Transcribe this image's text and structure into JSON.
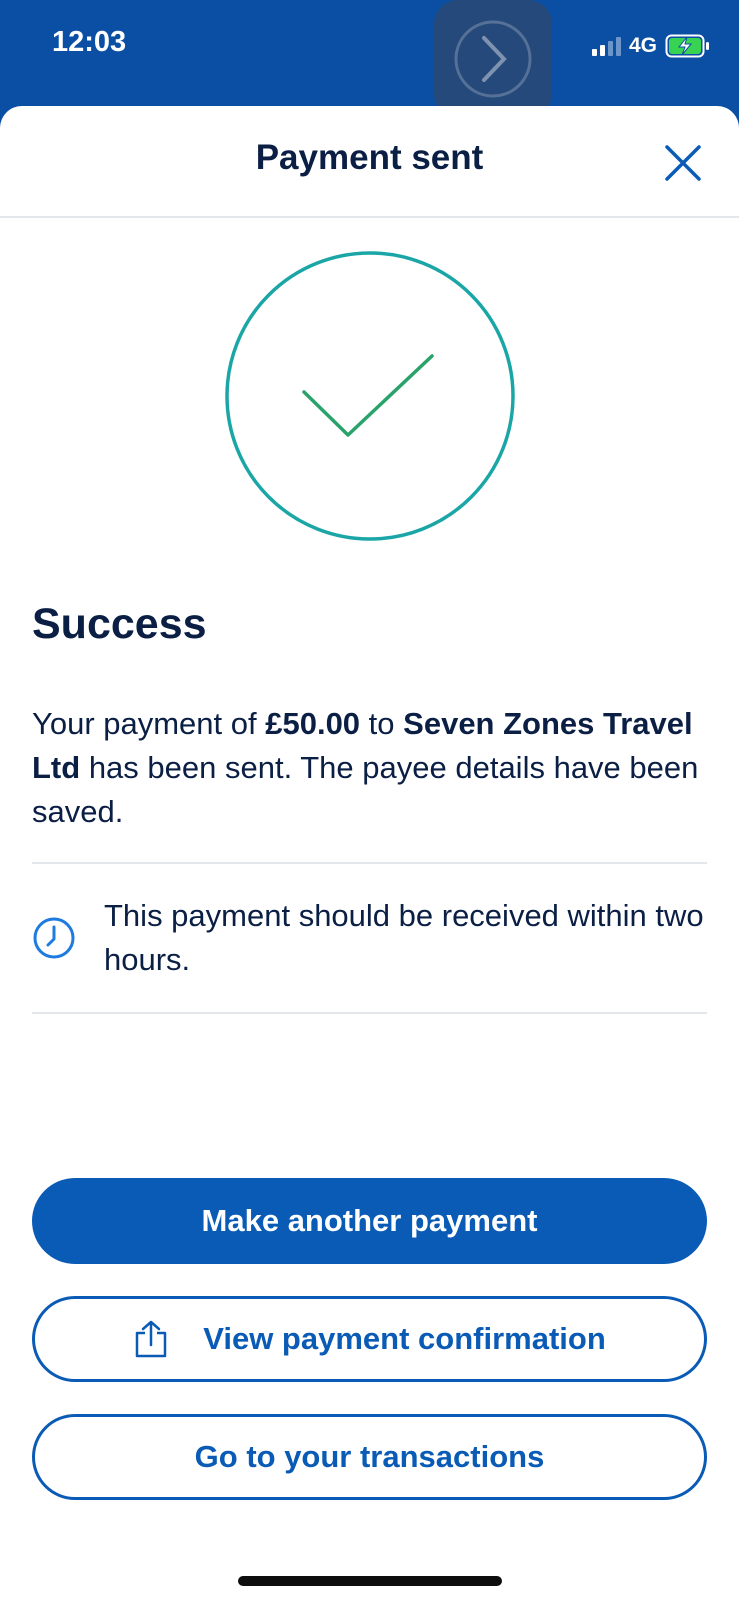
{
  "status_bar": {
    "time": "12:03",
    "network": "4G",
    "icons": [
      "signal-bars-icon",
      "battery-charging-icon"
    ]
  },
  "header": {
    "title": "Payment sent",
    "close_icon": "close-icon"
  },
  "success": {
    "icon": "checkmark-circle-icon",
    "heading": "Success",
    "message_part1": "Your payment of ",
    "amount": "£50.00",
    "message_part2": " to ",
    "payee": "Seven Zones Travel Ltd",
    "message_part3": " has been sent. The payee details have been saved."
  },
  "notice": {
    "icon": "clock-icon",
    "text": "This payment should be received within two hours."
  },
  "actions": {
    "make_another_label": "Make another payment",
    "view_confirmation_label": "View payment confirmation",
    "view_confirmation_icon": "share-icon",
    "transactions_label": "Go to your transactions"
  },
  "colors": {
    "brand_blue": "#0a5bb5",
    "status_bar_blue": "#0a4fa3",
    "text_navy": "#0b1f45",
    "circle_teal": "#1aa6a6",
    "check_green": "#2aa36b",
    "divider": "#e3e6ea"
  }
}
